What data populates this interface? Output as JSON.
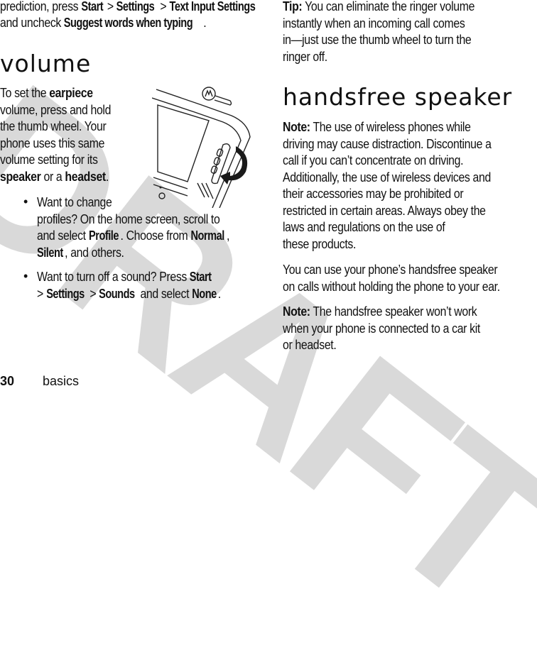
{
  "watermark": "DRAFT",
  "left_column": {
    "intro": {
      "line1_prefix": "prediction, press ",
      "path1": [
        "Start",
        "Settings",
        "Text Input Settings"
      ],
      "separator": " > ",
      "line2_prefix": "and uncheck ",
      "line2_cmd": "Suggest words when typing",
      "line2_suffix": "."
    },
    "volume_heading": "volume",
    "volume_para": {
      "l1_prefix": "To set the ",
      "l1_bold": "earpiece",
      "l2": "volume, press and hold",
      "l3": "the thumb wheel. Your",
      "l4": "phone uses this same",
      "l5": "volume setting for its",
      "l6_bold1": "speaker",
      "l6_mid": " or a ",
      "l6_bold2": "headset",
      "l6_end": "."
    },
    "bullets": [
      {
        "l1": "Want to change",
        "l2": "profiles? On the home screen, scroll to",
        "l3_prefix": "and select ",
        "l3_cmd": "Profile",
        "l3_mid": ". Choose from ",
        "l3_cmd2": "Normal",
        "l3_end": ",",
        "l4_cmd": "Silent",
        "l4_end": ", and others."
      },
      {
        "l1_prefix": "Want to turn off a sound? Press ",
        "l1_cmd": "Start",
        "l2_sep1": "> ",
        "l2_cmd1": "Settings",
        "l2_sep2": " > ",
        "l2_cmd2": "Sounds",
        "l2_mid": " and select ",
        "l2_cmd3": "None",
        "l2_end": "."
      }
    ],
    "bullet_glyph": "•"
  },
  "right_column": {
    "tip": {
      "label": "Tip:",
      "l1": " You can eliminate the ringer volume",
      "l2": "instantly when an incoming call comes",
      "l3": "in—just use the thumb wheel to turn the",
      "l4": "ringer off."
    },
    "handsfree_heading": "handsfree speaker",
    "note1": {
      "label": "Note:",
      "l1": " The use of wireless phones while",
      "l2": "driving may cause distraction. Discontinue a",
      "l3": "call if you can’t concentrate on driving.",
      "l4": "Additionally, the use of wireless devices and",
      "l5": "their accessories may be prohibited or",
      "l6": "restricted in certain areas. Always obey the",
      "l7": "laws and regulations on the use of",
      "l8": "these products."
    },
    "para": {
      "l1": "You can use your phone’s handsfree speaker",
      "l2": "on calls without holding the phone to your ear."
    },
    "note2": {
      "label": "Note:",
      "l1": " The handsfree speaker won’t work",
      "l2": "when your phone is connected to a car kit",
      "l3": "or headset."
    }
  },
  "footer": {
    "page_number": "30",
    "section": "basics"
  }
}
